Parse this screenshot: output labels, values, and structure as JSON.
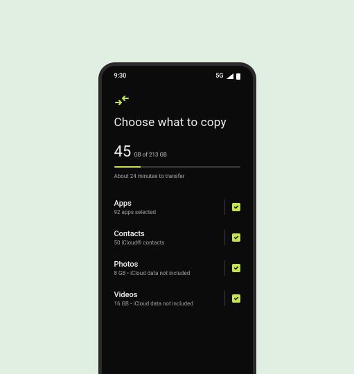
{
  "status": {
    "time": "9:30",
    "network": "5G"
  },
  "accent_color": "#c3e44e",
  "header": {
    "title": "Choose what to copy"
  },
  "storage": {
    "used_number": "45",
    "used_unit_and_total": "GB of 213 GB",
    "progress_percent": 21,
    "time_estimate": "About 24 minutes to transfer"
  },
  "items": [
    {
      "title": "Apps",
      "subtitle": "92 apps selected",
      "checked": true
    },
    {
      "title": "Contacts",
      "subtitle": "50 iCloud® contacts",
      "checked": true
    },
    {
      "title": "Photos",
      "subtitle": "8 GB • iCloud data not included",
      "checked": true
    },
    {
      "title": "Videos",
      "subtitle": "16 GB • iCloud data not included",
      "checked": true
    }
  ]
}
